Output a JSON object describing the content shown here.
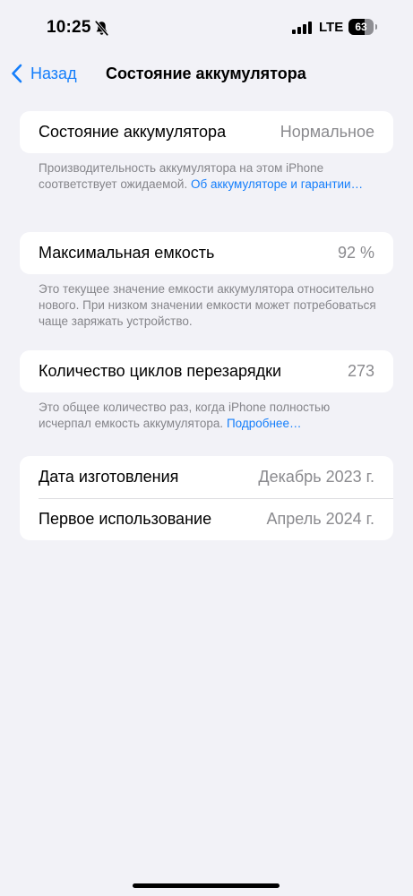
{
  "status_bar": {
    "time": "10:25",
    "network": "LTE",
    "battery_percent": "63",
    "battery_level": 0.63
  },
  "nav": {
    "back_label": "Назад",
    "title": "Состояние аккумулятора"
  },
  "sections": {
    "health": {
      "label": "Состояние аккумулятора",
      "value": "Нормальное",
      "footer_text": "Производительность аккумулятора на этом iPhone соответствует ожидаемой.",
      "footer_link": "Об аккумуляторе и гарантии…"
    },
    "capacity": {
      "label": "Максимальная емкость",
      "value": "92 %",
      "footer_text": "Это текущее значение емкости аккумулятора относительно нового. При низком значении емкости может потребоваться чаще заряжать устройство."
    },
    "cycles": {
      "label": "Количество циклов перезарядки",
      "value": "273",
      "footer_text": "Это общее количество раз, когда iPhone полностью исчерпал емкость аккумулятора.",
      "footer_link": "Подробнее…"
    },
    "dates": {
      "manufacture_label": "Дата изготовления",
      "manufacture_value": "Декабрь 2023 г.",
      "first_use_label": "Первое использование",
      "first_use_value": "Апрель 2024 г."
    }
  },
  "colors": {
    "accent": "#147efb",
    "background": "#f2f2f7",
    "secondary_text": "#8a8a8e"
  }
}
